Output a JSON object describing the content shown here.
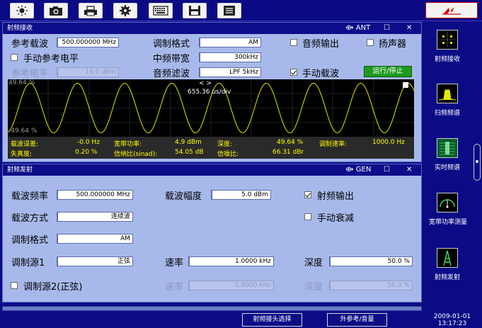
{
  "toolbar": {
    "buttons": [
      "brightness-icon",
      "camera-icon",
      "printer-icon",
      "gear-icon",
      "keyboard-icon",
      "save-icon",
      "document-icon"
    ]
  },
  "receive": {
    "title": "射频接收",
    "ant_label": "ANT",
    "ref_carrier_label": "参考载波",
    "ref_carrier_value": "500.000000 MHz",
    "mod_format_label": "调制格式",
    "mod_format_value": "AM",
    "audio_out_label": "音频输出",
    "speaker_label": "扬声器",
    "manual_ref_label": "手动参考电平",
    "if_bw_label": "中频带宽",
    "if_bw_value": "300kHz",
    "ref_level_label": "参考电平",
    "ref_level_value": "19.0 dBm",
    "audio_filter_label": "音频滤波",
    "audio_filter_value": "LPF 5kHz",
    "manual_carrier_label": "手动载波",
    "run_stop_label": "运行/停止",
    "scope": {
      "y_top": "49.64 %",
      "y_bottom": "-49.64 %",
      "nav": "<   >",
      "timebase": "655.36 us/div"
    },
    "readout": {
      "carrier_err_label": "载波误差:",
      "carrier_err_value": "-0.0  Hz",
      "wb_power_label": "宽带功率:",
      "wb_power_value": "4.9 dBm",
      "depth_label": "深度:",
      "depth_value": "49.64 %",
      "mod_rate_label": "调制速率:",
      "mod_rate_value": "1000.0  Hz",
      "distortion_label": "失真度:",
      "distortion_value": "0.20 %",
      "sinad_label": "信纳比(sinad):",
      "sinad_value": "54.05 dB",
      "snr_label": "信噪比:",
      "snr_value": "66.31 dBr"
    }
  },
  "transmit": {
    "title": "射频发射",
    "gen_label": "GEN",
    "carrier_freq_label": "载波频率",
    "carrier_freq_value": "500.000000 MHz",
    "carrier_amp_label": "载波幅度",
    "carrier_amp_value": "5.0 dBm",
    "rf_output_label": "射频输出",
    "carrier_mode_label": "载波方式",
    "carrier_mode_value": "连续波",
    "manual_atten_label": "手动衰减",
    "mod_format_label": "调制格式",
    "mod_format_value": "AM",
    "source1_label": "调制源1",
    "source1_value": "正弦",
    "rate1_label": "速率",
    "rate1_value": "1.0000 kHz",
    "depth1_label": "深度",
    "depth1_value": "50.0 %",
    "source2_label": "调制源2(正弦)",
    "rate2_label": "速率",
    "rate2_value": "1.0000 kHz",
    "depth2_label": "深度",
    "depth2_value": "50.0 %"
  },
  "sidenav": {
    "items": [
      {
        "label": "射频接收",
        "icon": "grid-icon"
      },
      {
        "label": "扫频频谱",
        "icon": "spectrum-icon"
      },
      {
        "label": "实时频谱",
        "icon": "realtime-spectrum-icon"
      },
      {
        "label": "宽带功率测量",
        "icon": "power-meter-icon"
      },
      {
        "label": "射频发射",
        "icon": "antenna-icon"
      }
    ]
  },
  "bottom": {
    "btn1": "射频接头选择",
    "btn2": "外参考/音量",
    "date": "2009-01-01",
    "time": "13:17:23"
  },
  "colors": {
    "trace": "#e4e400",
    "accent": "#0b0b86",
    "panel": "#a7b9ea",
    "run": "#1e9a1e"
  }
}
